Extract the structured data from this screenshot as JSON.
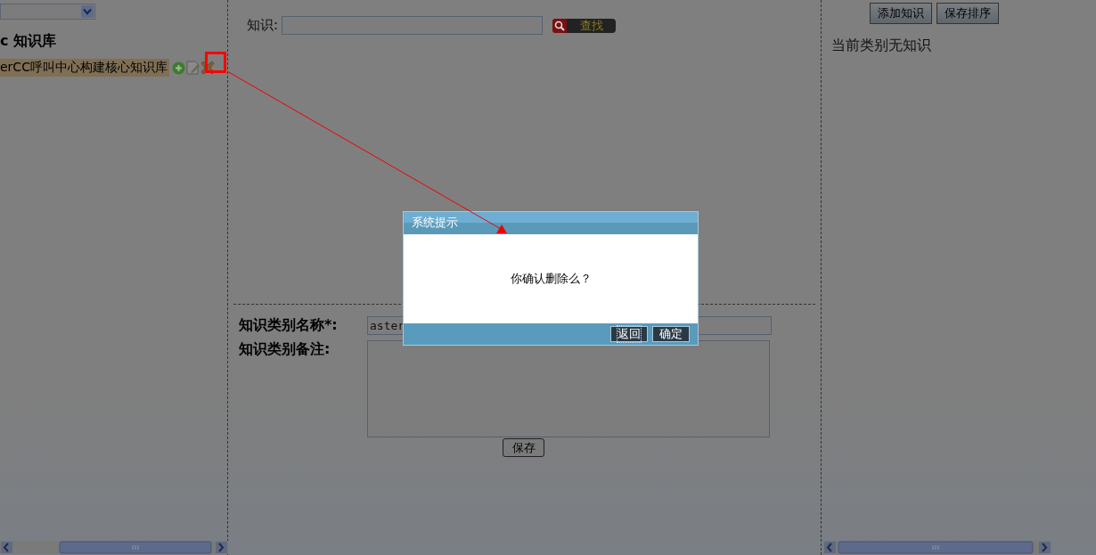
{
  "sidebar": {
    "title": "c 知识库",
    "tree": [
      {
        "label": "erCC呼叫中心构建核心知识库",
        "selected": true
      }
    ]
  },
  "search": {
    "label": "知识:",
    "button": "查找"
  },
  "toolbar": {
    "buttons": [
      "添加知识",
      "保存排序"
    ]
  },
  "knowledge_list": {
    "empty_message": "当前类别无知识"
  },
  "category_form": {
    "fields": [
      {
        "kind": "input",
        "label": "知识类别名称*:",
        "value": "aster"
      },
      {
        "kind": "textarea",
        "label": "知识类别备注:"
      }
    ],
    "save_button": "保存"
  },
  "dialog": {
    "title": "系统提示",
    "message": "你确认删除么？",
    "buttons": [
      {
        "label": "返回",
        "focused": true
      },
      {
        "label": "确定",
        "focused": false
      }
    ]
  },
  "annotation": {
    "highlight_delete_icon": true
  }
}
